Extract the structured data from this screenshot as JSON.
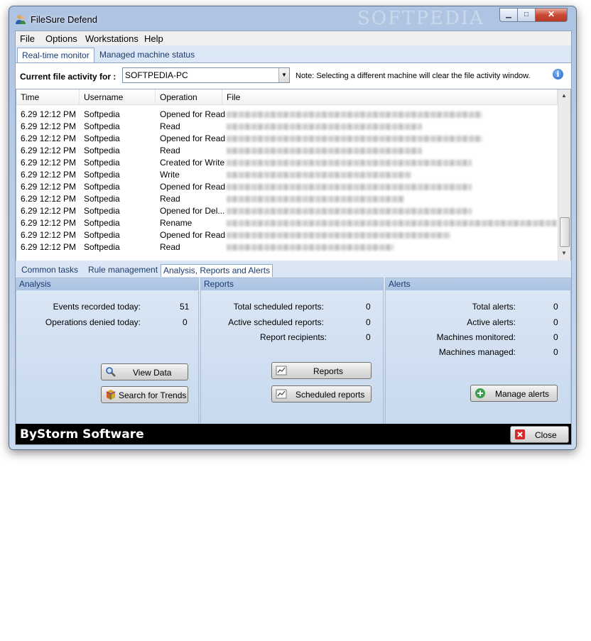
{
  "window": {
    "title": "FileSure Defend",
    "watermark": "SOFTPEDIA"
  },
  "menu": {
    "file": "File",
    "options": "Options",
    "workstations": "Workstations",
    "help": "Help"
  },
  "tabs": {
    "realtime": "Real-time monitor",
    "managed": "Managed machine status"
  },
  "activity": {
    "label": "Current file activity for :",
    "machine": "SOFTPEDIA-PC",
    "note": "Note: Selecting a different machine will clear the file activity window."
  },
  "grid": {
    "headers": {
      "time": "Time",
      "username": "Username",
      "operation": "Operation",
      "file": "File"
    },
    "rows": [
      {
        "time": "6.29 12:12 PM",
        "user": "Softpedia",
        "op": "Opened for Read"
      },
      {
        "time": "6.29 12:12 PM",
        "user": "Softpedia",
        "op": "Read"
      },
      {
        "time": "6.29 12:12 PM",
        "user": "Softpedia",
        "op": "Opened for Read"
      },
      {
        "time": "6.29 12:12 PM",
        "user": "Softpedia",
        "op": "Read"
      },
      {
        "time": "6.29 12:12 PM",
        "user": "Softpedia",
        "op": "Created for Write"
      },
      {
        "time": "6.29 12:12 PM",
        "user": "Softpedia",
        "op": "Write"
      },
      {
        "time": "6.29 12:12 PM",
        "user": "Softpedia",
        "op": "Opened for Read"
      },
      {
        "time": "6.29 12:12 PM",
        "user": "Softpedia",
        "op": "Read"
      },
      {
        "time": "6.29 12:12 PM",
        "user": "Softpedia",
        "op": "Opened for Del..."
      },
      {
        "time": "6.29 12:12 PM",
        "user": "Softpedia",
        "op": "Rename"
      },
      {
        "time": "6.29 12:12 PM",
        "user": "Softpedia",
        "op": "Opened for Read"
      },
      {
        "time": "6.29 12:12 PM",
        "user": "Softpedia",
        "op": "Read"
      }
    ]
  },
  "bottom_tabs": {
    "common": "Common tasks",
    "rules": "Rule management",
    "analysis": "Analysis, Reports and Alerts"
  },
  "analysis": {
    "title": "Analysis",
    "events_label": "Events recorded today:",
    "events_value": "51",
    "denied_label": "Operations denied today:",
    "denied_value": "0",
    "view_data": "View Data",
    "search_trends": "Search for Trends"
  },
  "reports": {
    "title": "Reports",
    "total_label": "Total scheduled reports:",
    "total_value": "0",
    "active_label": "Active scheduled reports:",
    "active_value": "0",
    "recipients_label": "Report recipients:",
    "recipients_value": "0",
    "reports_btn": "Reports",
    "scheduled_btn": "Scheduled reports"
  },
  "alerts": {
    "title": "Alerts",
    "total_label": "Total alerts:",
    "total_value": "0",
    "active_label": "Active alerts:",
    "active_value": "0",
    "monitored_label": "Machines monitored:",
    "monitored_value": "0",
    "managed_label": "Machines managed:",
    "managed_value": "0",
    "manage_btn": "Manage alerts"
  },
  "footer": {
    "brand": "ByStorm Software",
    "close": "Close"
  },
  "icons": {
    "app": "users-icon",
    "view_data": "magnifier-icon",
    "search_trends": "cube-icon",
    "reports": "chart-icon",
    "manage_alerts": "plus-circle-icon",
    "close": "close-icon",
    "info": "info-icon"
  }
}
